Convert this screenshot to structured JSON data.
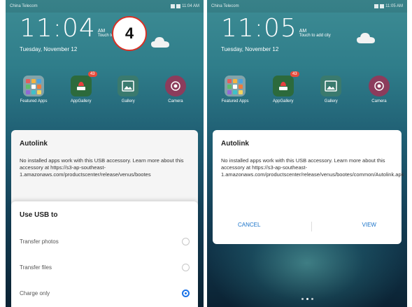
{
  "left_phone": {
    "status": {
      "carrier": "China Telecom",
      "time": "11:04 AM"
    },
    "clock": {
      "time": "11:04",
      "ampm": "AM",
      "touch_text": "Touch to"
    },
    "date": "Tuesday, November 12",
    "apps": [
      {
        "label": "Featured Apps",
        "icon": "tools-folder-icon"
      },
      {
        "label": "AppGallery",
        "icon": "appgallery-icon",
        "badge": "43"
      },
      {
        "label": "Gallery",
        "icon": "gallery-icon"
      },
      {
        "label": "Camera",
        "icon": "camera-icon"
      }
    ],
    "dialog": {
      "title": "Autolink",
      "body": "No installed apps work with this USB accessory. Learn more about this accessory at https://s3-ap-southeast-1.amazonaws.com/productscenter/release/venus/bootes"
    },
    "usb_sheet": {
      "title": "Use USB to",
      "options": [
        {
          "label": "Transfer photos",
          "checked": false
        },
        {
          "label": "Transfer files",
          "checked": false
        },
        {
          "label": "Charge only",
          "checked": true
        }
      ]
    }
  },
  "right_phone": {
    "status": {
      "carrier": "China Telecom",
      "time": "11:05 AM"
    },
    "clock": {
      "time": "11:05",
      "ampm": "AM",
      "touch_text": "Touch to add city"
    },
    "date": "Tuesday, November 12",
    "apps": [
      {
        "label": "Featured Apps",
        "icon": "tools-folder-icon"
      },
      {
        "label": "AppGallery",
        "icon": "appgallery-icon",
        "badge": "43"
      },
      {
        "label": "Gallery",
        "icon": "gallery-icon"
      },
      {
        "label": "Camera",
        "icon": "camera-icon"
      }
    ],
    "dialog": {
      "title": "Autolink",
      "body": "No installed apps work with this USB accessory. Learn more about this accessory at https://s3-ap-southeast-1.amazonaws.com/productscenter/release/venus/bootes/common/Autolink.apk",
      "cancel_label": "CANCEL",
      "view_label": "VIEW"
    }
  },
  "step_badge": "4",
  "colors": {
    "accent": "#1a73e8",
    "badge_ring": "#d93025",
    "notif_badge": "#e74a3b"
  }
}
